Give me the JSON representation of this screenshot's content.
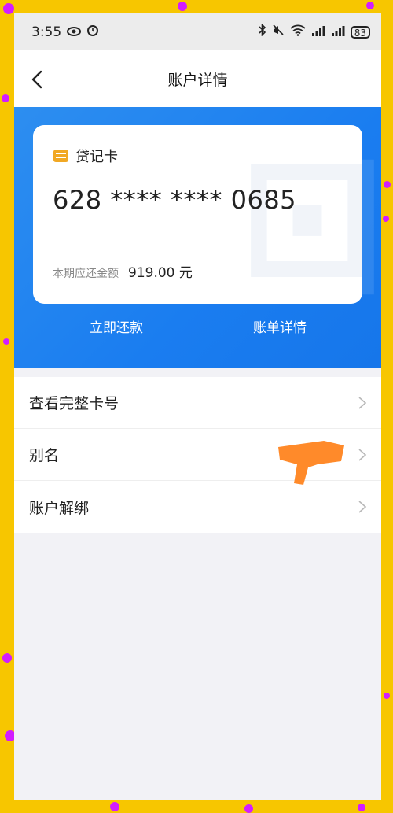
{
  "status_bar": {
    "time": "3:55",
    "battery": "83",
    "icons": [
      "eye-icon",
      "alarm-icon",
      "bluetooth-icon",
      "mute-icon",
      "wifi-icon",
      "signal-icon",
      "signal-icon",
      "battery-icon"
    ]
  },
  "nav": {
    "title": "账户详情",
    "back_icon": "chevron-left-icon"
  },
  "card": {
    "type_label": "贷记卡",
    "number": "628 **** **** 0685",
    "due_label": "本期应还金额",
    "due_amount": "919.00 元",
    "icon": "card-icon"
  },
  "actions": {
    "repay": "立即还款",
    "bill": "账单详情"
  },
  "menu": [
    {
      "label": "查看完整卡号"
    },
    {
      "label": "别名"
    },
    {
      "label": "账户解绑"
    }
  ],
  "colors": {
    "accent_blue": "#1a7df0",
    "card_icon": "#f1a824",
    "redaction": "#ff8a2a",
    "frame": "#f7c600"
  }
}
